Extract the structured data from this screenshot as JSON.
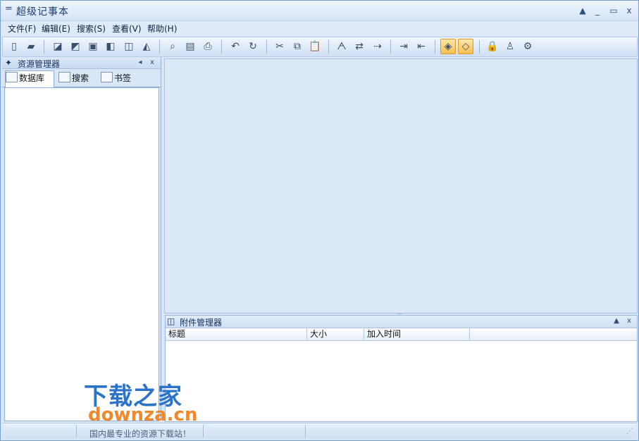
{
  "window": {
    "title": "超级记事本",
    "sysmenu_glyph": "=",
    "controls": {
      "restore": "▲",
      "minimize": "_",
      "maximize": "▭",
      "close": "x"
    }
  },
  "menubar": {
    "items": [
      "文件(F)",
      "编辑(E)",
      "搜索(S)",
      "查看(V)",
      "帮助(H)"
    ]
  },
  "toolbar": {
    "buttons": [
      {
        "icon": "new-file-icon",
        "glyph": "▯"
      },
      {
        "icon": "open-folder-icon",
        "glyph": "▰"
      },
      {
        "icon": "import-icon",
        "glyph": "◪"
      },
      {
        "icon": "export-icon",
        "glyph": "◩"
      },
      {
        "icon": "save-icon",
        "glyph": "▣"
      },
      {
        "icon": "save-all-icon",
        "glyph": "◧"
      },
      {
        "icon": "open-db-icon",
        "glyph": "◫"
      },
      {
        "icon": "close-db-icon",
        "glyph": "◭"
      },
      {
        "icon": "print-preview-icon",
        "glyph": "⌕"
      },
      {
        "icon": "page-setup-icon",
        "glyph": "▤"
      },
      {
        "icon": "print-icon",
        "glyph": "⎙"
      },
      {
        "icon": "undo-icon",
        "glyph": "↶"
      },
      {
        "icon": "redo-icon",
        "glyph": "↻"
      },
      {
        "icon": "cut-icon",
        "glyph": "✂"
      },
      {
        "icon": "copy-icon",
        "glyph": "⧉"
      },
      {
        "icon": "paste-icon",
        "glyph": "📋"
      },
      {
        "icon": "find-icon",
        "glyph": "ᗅ"
      },
      {
        "icon": "replace-icon",
        "glyph": "⇄"
      },
      {
        "icon": "find-next-icon",
        "glyph": "⇢"
      },
      {
        "icon": "indent-icon",
        "glyph": "⇥"
      },
      {
        "icon": "outdent-icon",
        "glyph": "⇤"
      },
      {
        "icon": "resource-manager-toggle-icon",
        "glyph": "◈"
      },
      {
        "icon": "attachment-manager-toggle-icon",
        "glyph": "◇"
      },
      {
        "icon": "lock-icon",
        "glyph": "🔒"
      },
      {
        "icon": "user-lock-icon",
        "glyph": "♙"
      },
      {
        "icon": "settings-icon",
        "glyph": "⚙"
      }
    ]
  },
  "resource_manager": {
    "title": "资源管理器",
    "icon": "resource-manager-icon",
    "pin_glyph": "◂",
    "close_glyph": "x",
    "tabs": [
      {
        "label": "数据库",
        "icon": "database-chart-icon"
      },
      {
        "label": "搜索",
        "icon": "search-window-icon"
      },
      {
        "label": "书签",
        "icon": "bookmark-folder-icon"
      }
    ]
  },
  "attachment_manager": {
    "title": "附件管理器",
    "icon": "attachment-manager-icon",
    "up_glyph": "▲",
    "close_glyph": "x",
    "columns": [
      "标题",
      "大小",
      "加入时间",
      ""
    ]
  },
  "watermark": {
    "cn": "下载之家",
    "en": "downza.cn",
    "sub": "国内最专业的资源下载站！"
  }
}
